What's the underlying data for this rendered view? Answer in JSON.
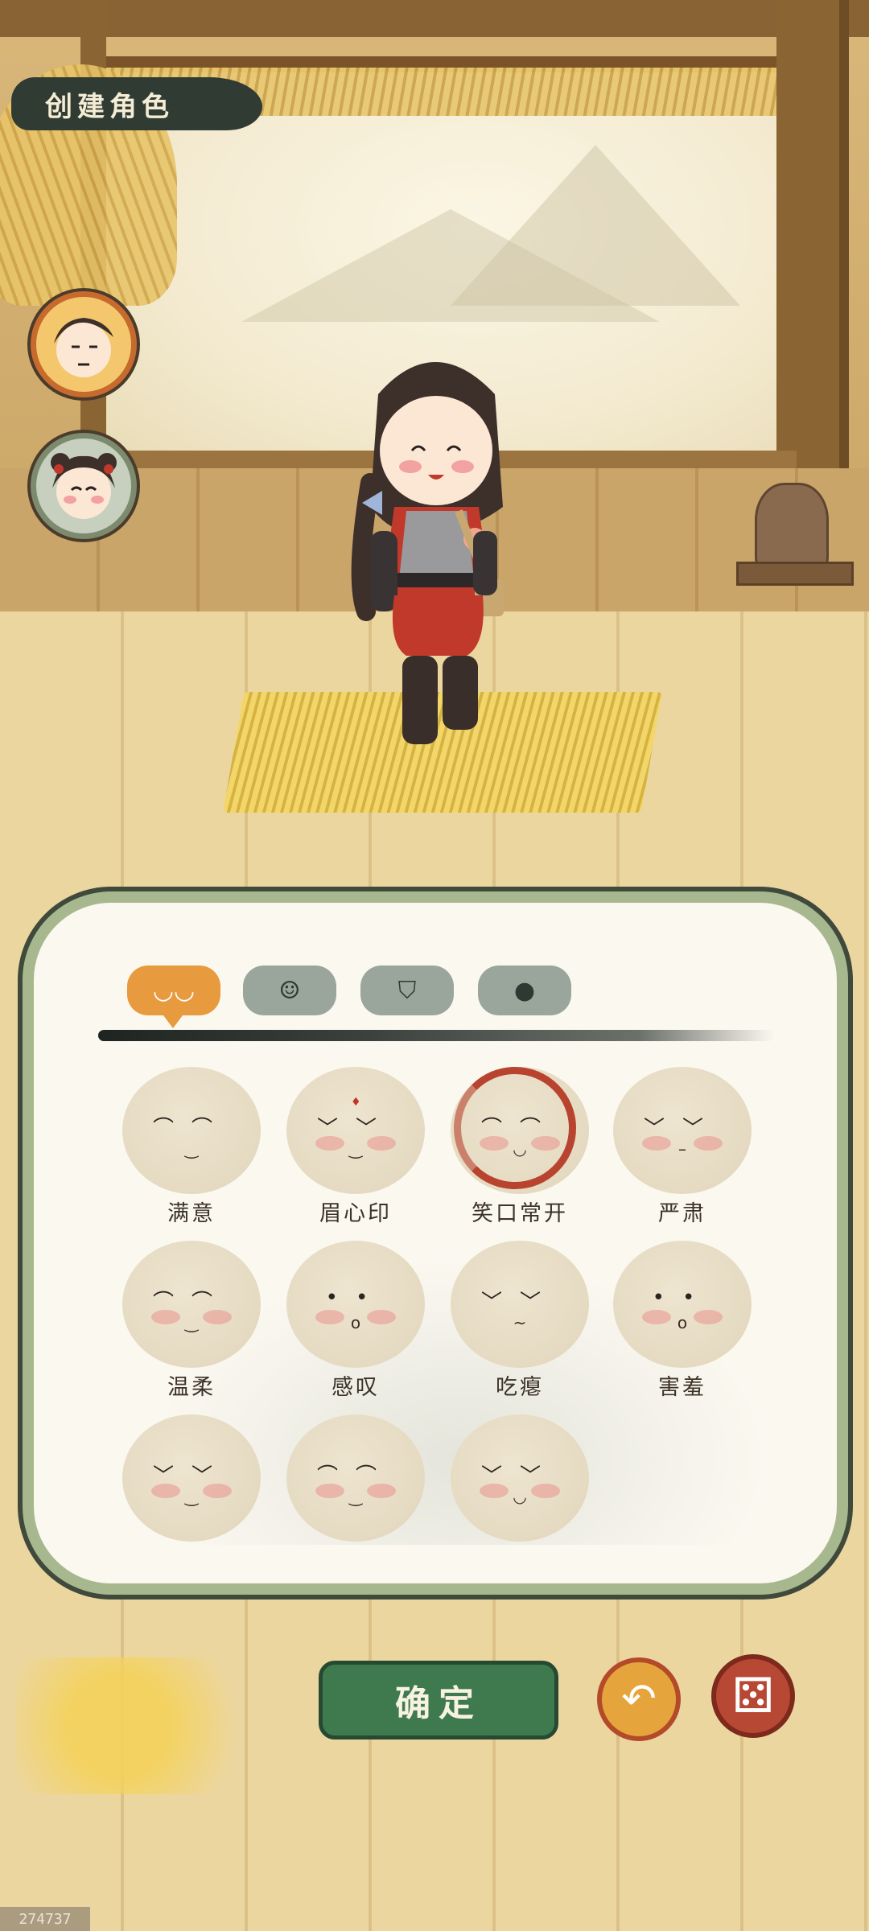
{
  "title": "创建角色",
  "characters": [
    {
      "icon": "boy-portrait-icon"
    },
    {
      "icon": "girl-portrait-icon"
    }
  ],
  "tabs": [
    {
      "icon": "face-expression-icon",
      "glyph": "◡◡",
      "active": true
    },
    {
      "icon": "hairstyle-icon",
      "glyph": "☺",
      "active": false
    },
    {
      "icon": "clothing-icon",
      "glyph": "⛉",
      "active": false
    },
    {
      "icon": "head-shape-icon",
      "glyph": "●",
      "active": false
    }
  ],
  "expressions": [
    {
      "label": "满意",
      "eyes": "⌒⌒",
      "mouth": "‿",
      "selected": false
    },
    {
      "label": "眉心印",
      "eyes": "﹀﹀",
      "mouth": "‿",
      "selected": false
    },
    {
      "label": "笑口常开",
      "eyes": "⌒⌒",
      "mouth": "◡",
      "selected": true
    },
    {
      "label": "严肃",
      "eyes": "﹀﹀",
      "mouth": "–",
      "selected": false
    },
    {
      "label": "温柔",
      "eyes": "⌒⌒",
      "mouth": "‿",
      "selected": false
    },
    {
      "label": "感叹",
      "eyes": "••",
      "mouth": "o",
      "selected": false
    },
    {
      "label": "吃瘪",
      "eyes": "﹀﹀",
      "mouth": "~",
      "selected": false
    },
    {
      "label": "害羞",
      "eyes": "••",
      "mouth": "o",
      "selected": false
    },
    {
      "label": "",
      "eyes": "﹀﹀",
      "mouth": "‿",
      "selected": false
    },
    {
      "label": "",
      "eyes": "⌒⌒",
      "mouth": "‿",
      "selected": false
    },
    {
      "label": "",
      "eyes": "﹀﹀",
      "mouth": "◡",
      "selected": false
    }
  ],
  "buttons": {
    "confirm_label": "确定",
    "undo_icon": "undo-arrow-icon",
    "undo_glyph": "↶",
    "random_icon": "dice-icon",
    "random_glyph": "⚄"
  },
  "watermark": "274737",
  "colors": {
    "accent_orange": "#e89a3f",
    "confirm_green": "#3f7a4e",
    "selected_ring": "#b8432e",
    "panel_border": "#a8b88e"
  }
}
